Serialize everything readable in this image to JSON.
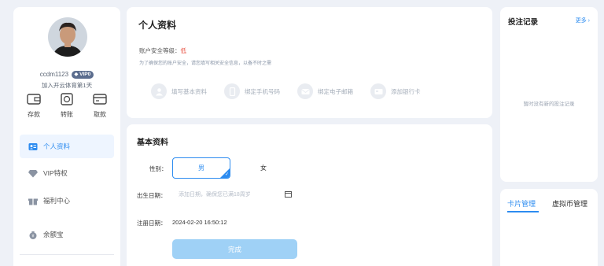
{
  "sidebar": {
    "username": "ccdm1123",
    "vip_badge": "VIP0",
    "join_text": "加入开云体育第1天",
    "wallet_actions": [
      {
        "label": "存款",
        "icon": "deposit-icon"
      },
      {
        "label": "转账",
        "icon": "transfer-icon"
      },
      {
        "label": "取款",
        "icon": "withdraw-icon"
      }
    ],
    "menu": [
      {
        "label": "个人资料",
        "icon": "id-card-icon",
        "active": true
      },
      {
        "label": "VIP特权",
        "icon": "diamond-icon",
        "active": false
      },
      {
        "label": "福利中心",
        "icon": "gift-icon",
        "active": false
      },
      {
        "label": "余额宝",
        "icon": "money-bag-icon",
        "active": false
      }
    ]
  },
  "profile": {
    "title": "个人资料",
    "security_label": "账户安全等级：",
    "security_level": "低",
    "security_tip": "为了确保您的账户安全，请您填写相关安全信息，以备不时之需",
    "bind_items": [
      {
        "label": "填写基本资料",
        "icon": "user-icon"
      },
      {
        "label": "绑定手机号码",
        "icon": "phone-icon"
      },
      {
        "label": "绑定电子邮箱",
        "icon": "email-icon"
      },
      {
        "label": "添加银行卡",
        "icon": "bank-card-icon"
      }
    ]
  },
  "basic": {
    "title": "基本资料",
    "gender_label": "性别：",
    "gender_male": "男",
    "gender_female": "女",
    "birth_label": "出生日期：",
    "birth_placeholder": "添加日期，确保您已满18周岁",
    "reg_label": "注册日期：",
    "reg_value": "2024-02-20 16:50:12",
    "submit": "完成"
  },
  "bets": {
    "title": "投注记录",
    "more": "更多 ›",
    "empty": "暂时没有新的投注记录"
  },
  "cards": {
    "tabs": [
      "卡片管理",
      "虚拟币管理"
    ]
  },
  "colors": {
    "accent": "#2d8cf0",
    "danger": "#e74c3c",
    "vip_badge": "#5b6d8e",
    "submit": "#9fd1f6"
  }
}
